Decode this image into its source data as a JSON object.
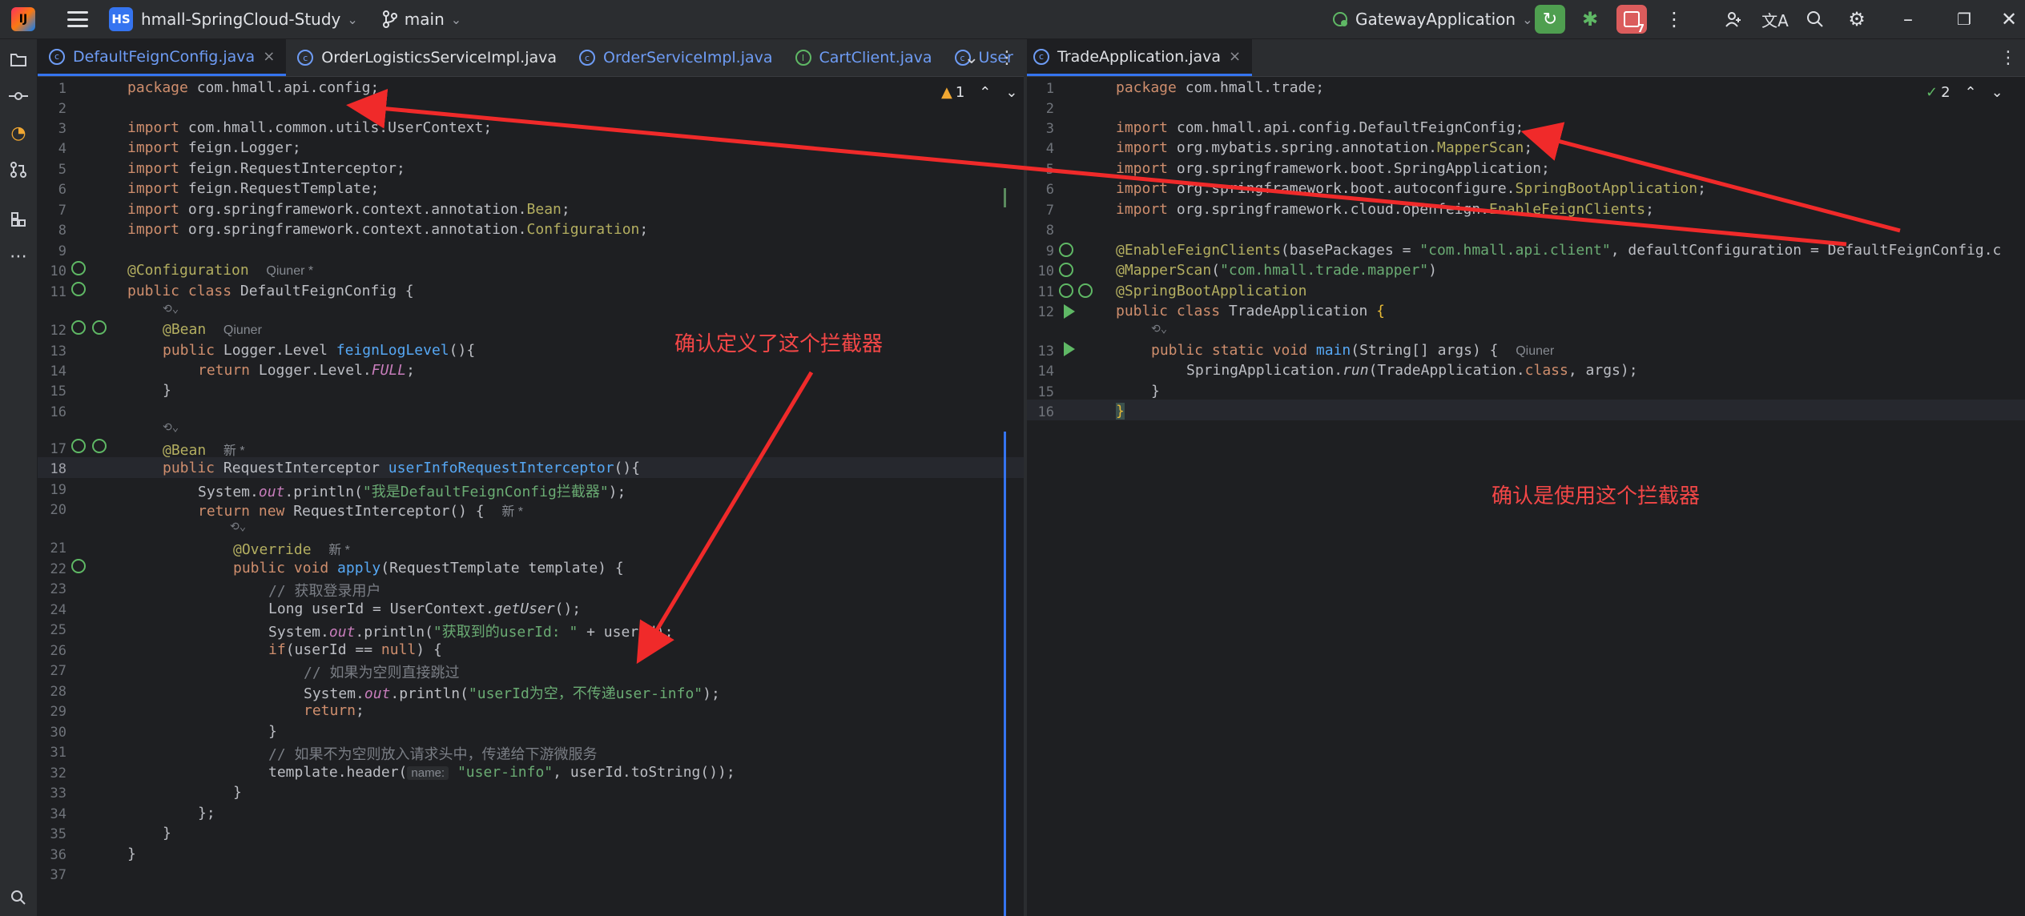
{
  "topbar": {
    "project_badge": "HS",
    "project_name": "hmall-SpringCloud-Study",
    "branch": "main",
    "run_config": "GatewayApplication",
    "rerun_badge": "7"
  },
  "left_tabs": [
    {
      "label": "DefaultFeignConfig.java",
      "close": "×"
    },
    {
      "label": "OrderLogisticsServiceImpl.java"
    },
    {
      "label": "OrderServiceImpl.java"
    },
    {
      "label": "CartClient.java"
    },
    {
      "label": "User"
    }
  ],
  "right_tabs": [
    {
      "label": "TradeApplication.java",
      "close": "×"
    }
  ],
  "left_editor": {
    "warning_count": "1",
    "line_numbers": [
      "1",
      "2",
      "3",
      "4",
      "5",
      "6",
      "7",
      "8",
      "9",
      "10",
      "11",
      "12",
      "13",
      "14",
      "15",
      "16",
      "17",
      "18",
      "19",
      "20",
      "21",
      "22",
      "23",
      "24",
      "25",
      "26",
      "27",
      "28",
      "29",
      "30",
      "31",
      "32",
      "33",
      "34",
      "35",
      "36",
      "37"
    ],
    "inlay_author_1": "Qiuner *",
    "inlay_author_2": "Qiuner",
    "inlay_new_1": "新 *",
    "inlay_new_2": "新 *",
    "inlay_new_3": "新 *",
    "param_hint": "name:",
    "lines": {
      "l1_kw": "package",
      "l1_rest": " com.hmall.api.config;",
      "l3": "com.hmall.common.utils.UserContext;",
      "l4": "feign.Logger;",
      "l5": "feign.RequestInterceptor;",
      "l6": "feign.RequestTemplate;",
      "l7_a": "org.springframework.context.annotation.",
      "l7_b": "Bean",
      "l8_a": "org.springframework.context.annotation.",
      "l8_b": "Configuration",
      "import_kw": "import",
      "l10": "@Configuration",
      "l11_a": "public class",
      "l11_b": " DefaultFeignConfig {",
      "l12": "@Bean",
      "l13_a": "public",
      "l13_b": " Logger.Level ",
      "l13_c": "feignLogLevel",
      "l13_d": "(){",
      "l14_a": "return",
      "l14_b": " Logger.Level.",
      "l14_c": "FULL",
      "l14_d": ";",
      "l15": "}",
      "l17": "@Bean",
      "l18_a": "public",
      "l18_b": " RequestInterceptor ",
      "l18_c": "userInfoRequestInterceptor",
      "l18_d": "(){",
      "l19_a": "System.",
      "l19_b": "out",
      "l19_c": ".println(",
      "l19_d": "\"我是DefaultFeignConfig拦截器\"",
      "l19_e": ");",
      "l20_a": "return new",
      "l20_b": " RequestInterceptor() {",
      "l21": "@Override",
      "l22_a": "public void",
      "l22_b": " apply",
      "l22_c": "(RequestTemplate template) {",
      "l23": "// 获取登录用户",
      "l24_a": "Long userId = UserContext.",
      "l24_b": "getUser",
      "l24_c": "();",
      "l25_a": "System.",
      "l25_b": "out",
      "l25_c": ".println(",
      "l25_d": "\"获取到的userId: \"",
      "l25_e": " + userId);",
      "l26_a": "if",
      "l26_b": "(userId == ",
      "l26_c": "null",
      "l26_d": ") {",
      "l27": "// 如果为空则直接跳过",
      "l28_a": "System.",
      "l28_b": "out",
      "l28_c": ".println(",
      "l28_d": "\"userId为空，不传递user-info\"",
      "l28_e": ");",
      "l29_a": "return",
      "l29_b": ";",
      "l30": "}",
      "l31": "// 如果不为空则放入请求头中，传递给下游微服务",
      "l32_a": "template.header(",
      "l32_b": "\"user-info\"",
      "l32_c": ", userId.toString());",
      "l33": "}",
      "l34": "};",
      "l35": "}",
      "l36": "}"
    }
  },
  "right_editor": {
    "check_count": "2",
    "line_numbers": [
      "1",
      "2",
      "3",
      "4",
      "5",
      "6",
      "7",
      "8",
      "9",
      "10",
      "11",
      "12",
      "13",
      "14",
      "15",
      "16"
    ],
    "inlay_author": "Qiuner",
    "lines": {
      "l1_kw": "package",
      "l1_rest": " com.hmall.trade;",
      "import_kw": "import",
      "l3": "com.hmall.api.config.DefaultFeignConfig;",
      "l4_a": "org.mybatis.spring.annotation.",
      "l4_b": "MapperScan",
      "l5": "org.springframework.boot.SpringApplication;",
      "l6_a": "org.springframework.boot.autoconfigure.",
      "l6_b": "SpringBootApplication",
      "l7_a": "org.springframework.cloud.openfeign.",
      "l7_b": "EnableFeignClients",
      "semi": ";",
      "l9_a": "@EnableFeignClients",
      "l9_b": "(basePackages = ",
      "l9_c": "\"com.hmall.api.client\"",
      "l9_d": ", defaultConfiguration = DefaultFeignConfig.c",
      "l10_a": "@MapperScan",
      "l10_b": "(",
      "l10_c": "\"com.hmall.trade.mapper\"",
      "l10_d": ")",
      "l11": "@SpringBootApplication",
      "l12_a": "public class",
      "l12_b": " TradeApplication ",
      "l12_c": "{",
      "l13_a": "public static void",
      "l13_b": " main",
      "l13_c": "(String[] args) {",
      "l14_a": "SpringApplication.",
      "l14_b": "run",
      "l14_c": "(TradeApplication.",
      "l14_d": "class",
      "l14_e": ", args);",
      "l15": "}",
      "l16": "}"
    }
  },
  "annotations": {
    "left_note": "确认定义了这个拦截器",
    "right_note": "确认是使用这个拦截器"
  },
  "colors": {
    "annotation_red": "#f44747",
    "accent_blue": "#3574f0"
  }
}
